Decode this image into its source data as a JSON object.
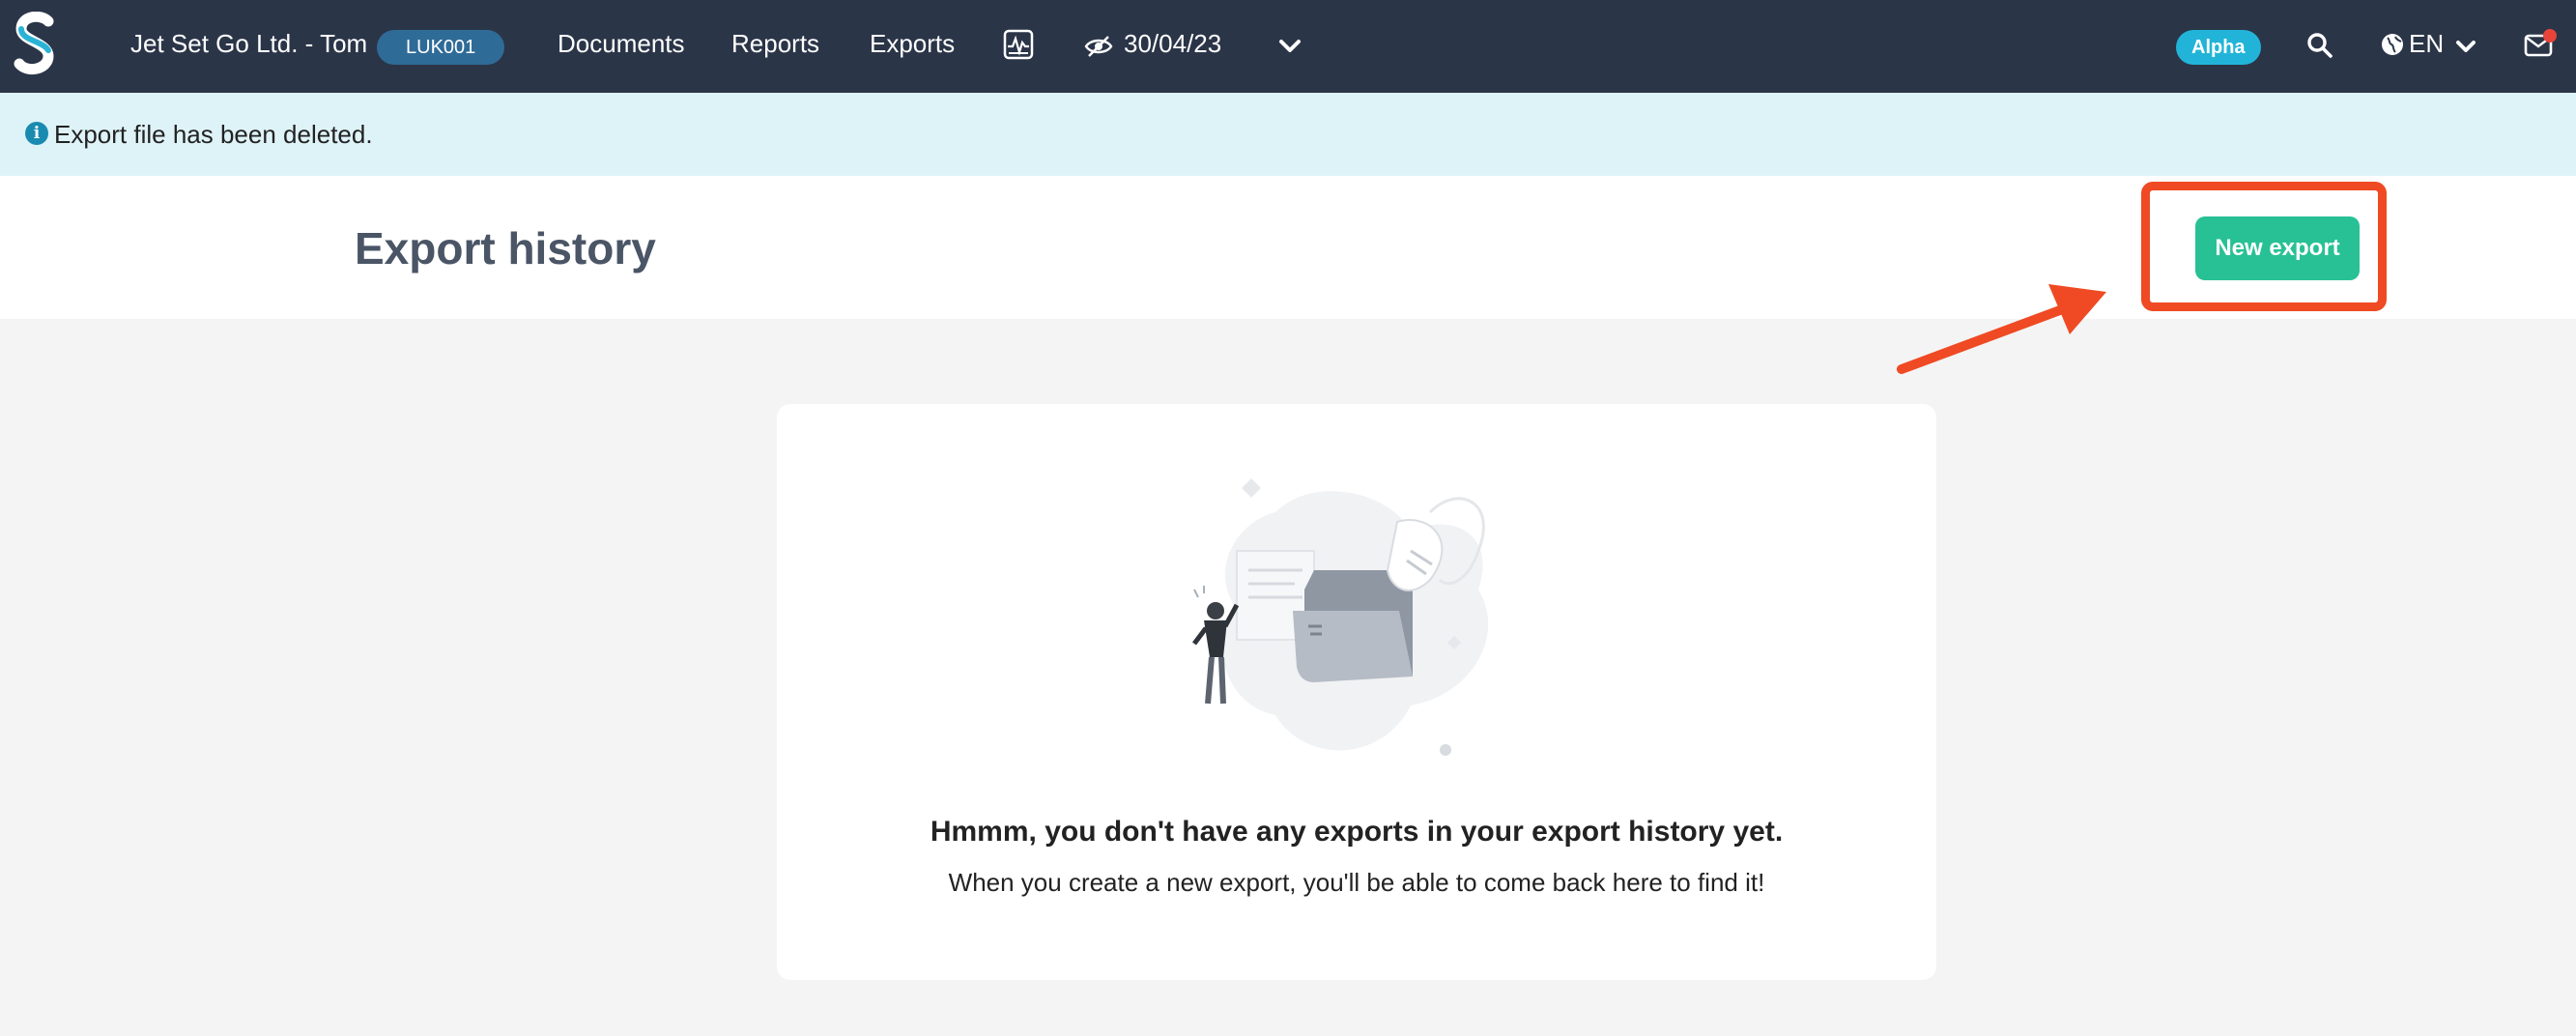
{
  "topbar": {
    "company": "Jet Set Go Ltd. - Tom",
    "code_badge": "LUK001",
    "nav": {
      "documents": "Documents",
      "reports": "Reports",
      "exports": "Exports"
    },
    "date": "30/04/23",
    "alpha_badge": "Alpha",
    "language": "EN"
  },
  "banner": {
    "message": "Export file has been deleted."
  },
  "header": {
    "title": "Export history",
    "new_export_label": "New export"
  },
  "empty_state": {
    "title": "Hmmm, you don't have any exports in your export history yet.",
    "subtitle": "When you create a new export, you'll be able to come back here to find it!"
  },
  "colors": {
    "topbar": "#2b3548",
    "banner": "#def3f8",
    "primary_button": "#28c195",
    "annotation": "#ef4a23",
    "alpha_badge": "#22b4d8"
  }
}
